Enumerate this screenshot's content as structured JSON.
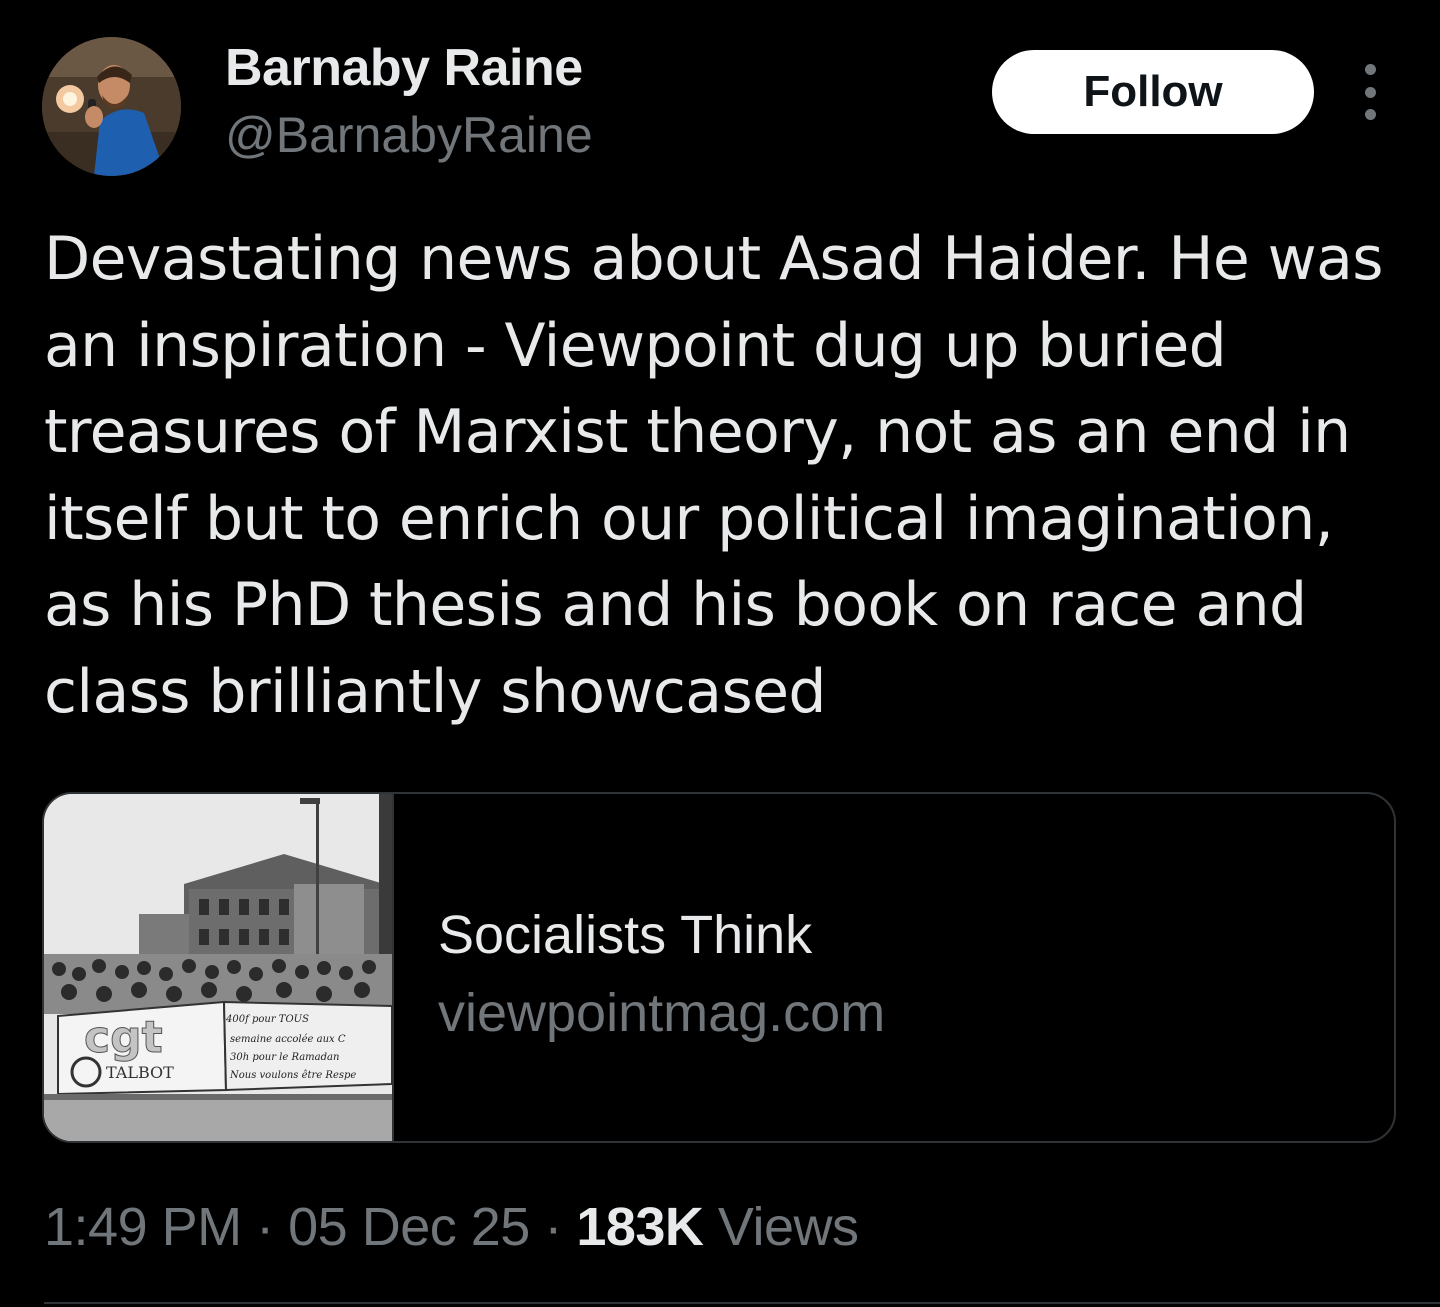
{
  "author": {
    "name": "Barnaby Raine",
    "handle": "@BarnabyRaine",
    "avatar_icon": "profile-photo"
  },
  "follow_label": "Follow",
  "more_icon": "vertical-ellipsis-icon",
  "tweet_text": "Devastating news about Asad Haider. He was an inspiration - Viewpoint dug up buried treasures of Marxist theory, not as an end in itself but to enrich our political imagination, as his PhD thesis and his book on race and class brilliantly showcased",
  "link_card": {
    "title": "Socialists Think",
    "domain": "viewpointmag.com",
    "image": {
      "banner_logo": "cgt",
      "banner_brand": "TALBOT",
      "banner_lines": [
        "400f pour TOUS",
        "semaine accolée aux C",
        "30h pour le Ramadan",
        "Nous voulons être Respe"
      ]
    }
  },
  "meta": {
    "time": "1:49 PM",
    "separator": "·",
    "date": "05 Dec 25",
    "views_count": "183K",
    "views_label": "Views"
  },
  "colors": {
    "background": "#000000",
    "text_primary": "#e7e9ea",
    "text_secondary": "#71767b",
    "border": "#2f3336",
    "follow_bg": "#ffffff"
  }
}
